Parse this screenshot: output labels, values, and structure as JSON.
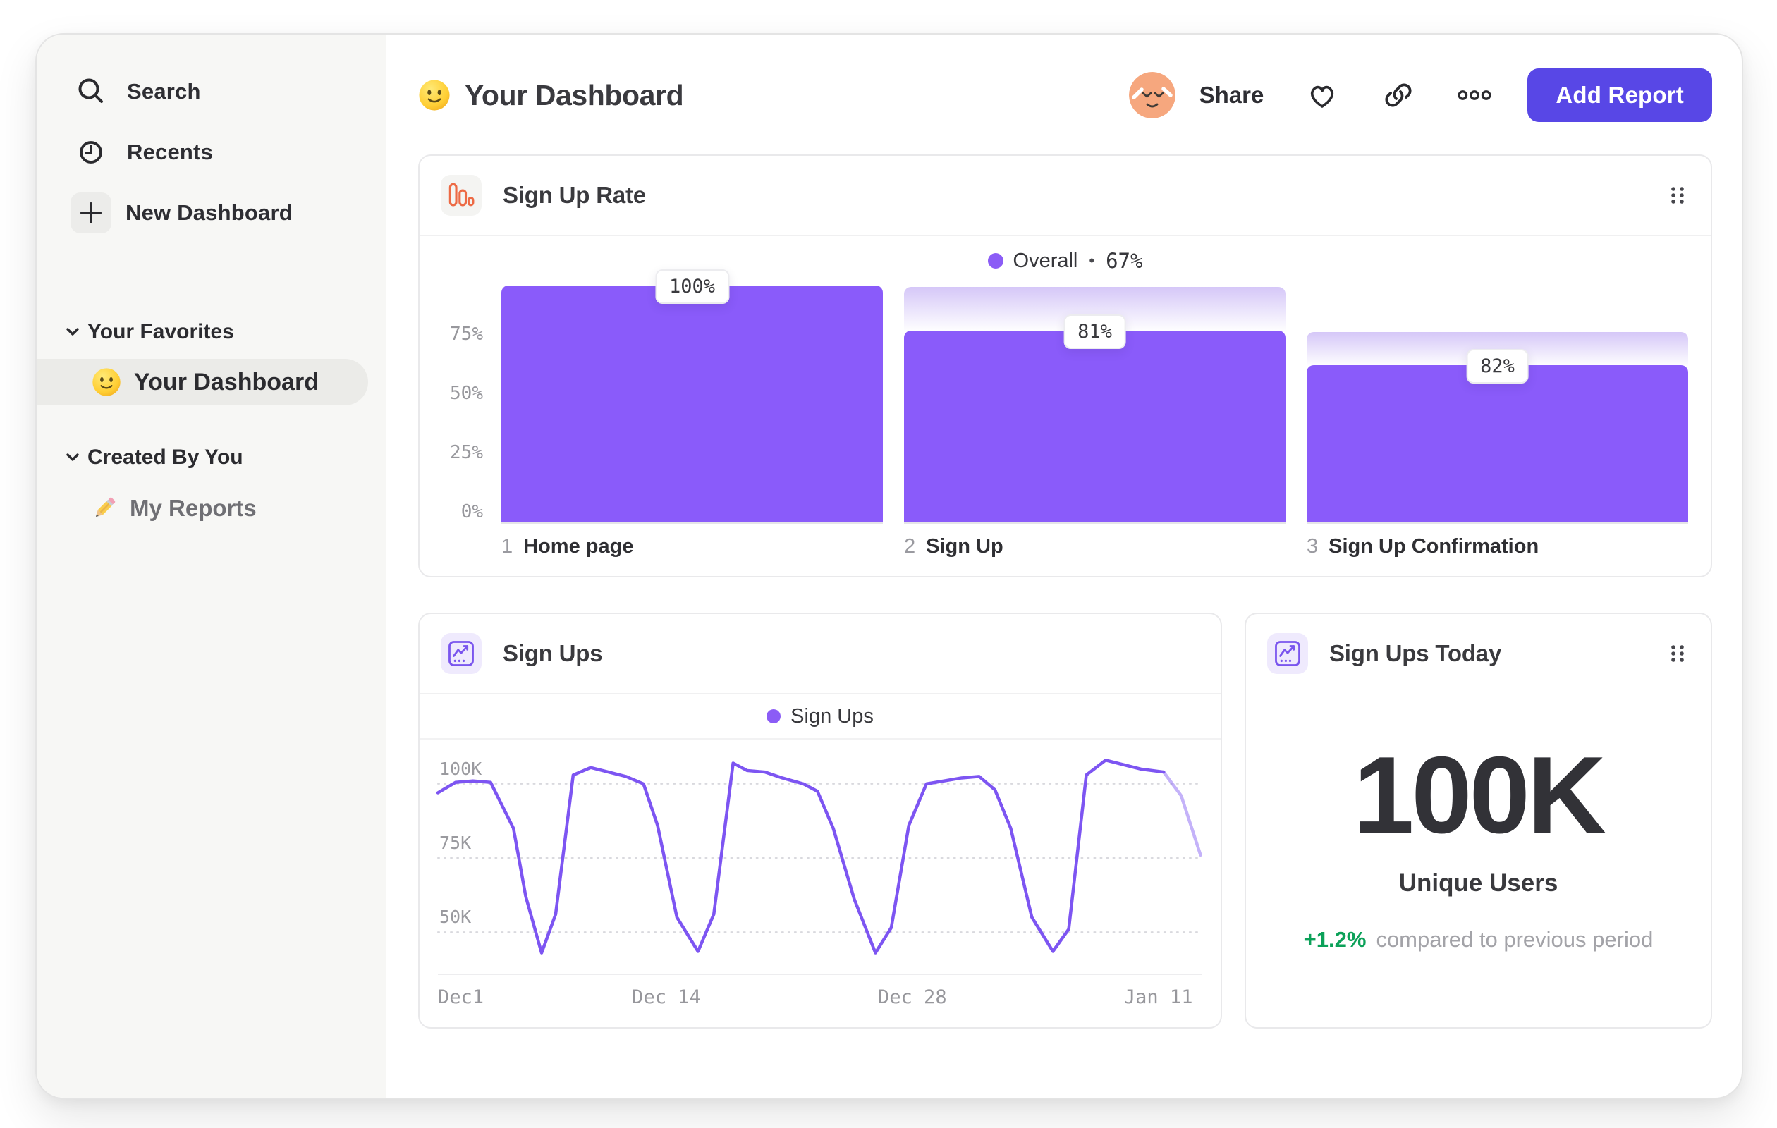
{
  "sidebar": {
    "items": [
      {
        "label": "Search",
        "icon": "search-icon"
      },
      {
        "label": "Recents",
        "icon": "clock-icon"
      },
      {
        "label": "New Dashboard",
        "icon": "plus-icon"
      }
    ],
    "sections": [
      {
        "label": "Your Favorites",
        "items": [
          {
            "label": "Your Dashboard",
            "icon": "smiley-emoji",
            "active": true
          }
        ]
      },
      {
        "label": "Created By You",
        "items": [
          {
            "label": "My Reports",
            "icon": "pencil-icon",
            "active": false
          }
        ]
      }
    ]
  },
  "header": {
    "title": "Your Dashboard",
    "share_label": "Share",
    "add_report_label": "Add Report"
  },
  "cards": {
    "signup_rate": {
      "title": "Sign Up Rate",
      "legend": {
        "series": "Overall",
        "separator": "•",
        "value": "67%"
      }
    },
    "signups": {
      "title": "Sign Ups",
      "legend": {
        "series": "Sign Ups"
      }
    },
    "signups_today": {
      "title": "Sign Ups Today",
      "value": "100K",
      "label": "Unique Users",
      "delta": "+1.2%",
      "note": "compared to previous period"
    }
  },
  "colors": {
    "bar_purple": "#8A5BFA",
    "line_purple": "#7D55F2",
    "legend_dot_purple": "#8B5CF6",
    "button_indigo": "#5847E6",
    "positive_green": "#0CA159",
    "funnel_icon_orange": "#ED6A45"
  },
  "chart_data": [
    {
      "type": "bar",
      "subtype": "funnel",
      "title": "Sign Up Rate",
      "legend": [
        {
          "name": "Overall",
          "value_label": "67%",
          "value_pct": 67
        }
      ],
      "ylim": [
        0,
        100
      ],
      "y_ticks": [
        {
          "label": "75%",
          "value": 75
        },
        {
          "label": "50%",
          "value": 50
        },
        {
          "label": "25%",
          "value": 25
        },
        {
          "label": "0%",
          "value": 0
        }
      ],
      "steps": [
        {
          "index": "1",
          "label": "Home page",
          "step_conversion_label": "100%",
          "step_conversion_pct": 100,
          "cumulative_pct": 100
        },
        {
          "index": "2",
          "label": "Sign Up",
          "step_conversion_label": "81%",
          "step_conversion_pct": 81,
          "cumulative_pct": 81
        },
        {
          "index": "3",
          "label": "Sign Up Confirmation",
          "step_conversion_label": "82%",
          "step_conversion_pct": 82,
          "cumulative_pct": 66.4
        }
      ]
    },
    {
      "type": "line",
      "title": "Sign Ups",
      "legend_position": "top-center",
      "grid": "dotted-horizontal",
      "x_ticks": [
        {
          "label": "Dec1",
          "day": 0
        },
        {
          "label": "Dec 14",
          "day": 13
        },
        {
          "label": "Dec 28",
          "day": 27
        },
        {
          "label": "Jan 11",
          "day": 41
        }
      ],
      "y_ticks": [
        {
          "label": "100K",
          "value_k": 100
        },
        {
          "label": "75K",
          "value_k": 75
        },
        {
          "label": "50K",
          "value_k": 50
        }
      ],
      "xlim_days": [
        0,
        43.5
      ],
      "ylim_k": [
        36,
        114
      ],
      "series": [
        {
          "name": "Sign Ups",
          "units": "thousands of sign ups per day",
          "faded_from_day": 41.3,
          "points_day_value_k": [
            [
              0,
              97
            ],
            [
              1,
              100.5
            ],
            [
              2,
              101
            ],
            [
              3,
              100.5
            ],
            [
              4.3,
              85
            ],
            [
              5,
              62
            ],
            [
              5.9,
              43
            ],
            [
              6.7,
              56
            ],
            [
              7.7,
              103
            ],
            [
              8.7,
              105.5
            ],
            [
              9.7,
              104
            ],
            [
              10.7,
              102.5
            ],
            [
              11.7,
              100
            ],
            [
              12.5,
              86
            ],
            [
              13.6,
              55
            ],
            [
              14.8,
              43.5
            ],
            [
              15.7,
              56
            ],
            [
              16.8,
              107
            ],
            [
              17.6,
              104.5
            ],
            [
              18.6,
              104
            ],
            [
              19.6,
              102
            ],
            [
              20.8,
              100
            ],
            [
              21.6,
              97.5
            ],
            [
              22.5,
              85
            ],
            [
              23.7,
              61
            ],
            [
              24.9,
              43
            ],
            [
              25.8,
              51.5
            ],
            [
              26.8,
              86
            ],
            [
              27.8,
              100
            ],
            [
              28.8,
              101
            ],
            [
              29.8,
              102
            ],
            [
              30.8,
              102.5
            ],
            [
              31.7,
              98
            ],
            [
              32.6,
              85
            ],
            [
              33.8,
              55
            ],
            [
              35,
              43.5
            ],
            [
              35.9,
              51
            ],
            [
              36.9,
              103
            ],
            [
              38,
              108
            ],
            [
              39,
              106.5
            ],
            [
              40,
              105
            ],
            [
              41.3,
              104
            ],
            [
              42.3,
              96
            ],
            [
              43.4,
              76
            ]
          ]
        }
      ]
    },
    {
      "type": "metric",
      "title": "Sign Ups Today",
      "value": "100K",
      "label": "Unique Users",
      "delta_label": "+1.2%",
      "delta_pct": 1.2,
      "comparison": "compared to previous period"
    }
  ]
}
